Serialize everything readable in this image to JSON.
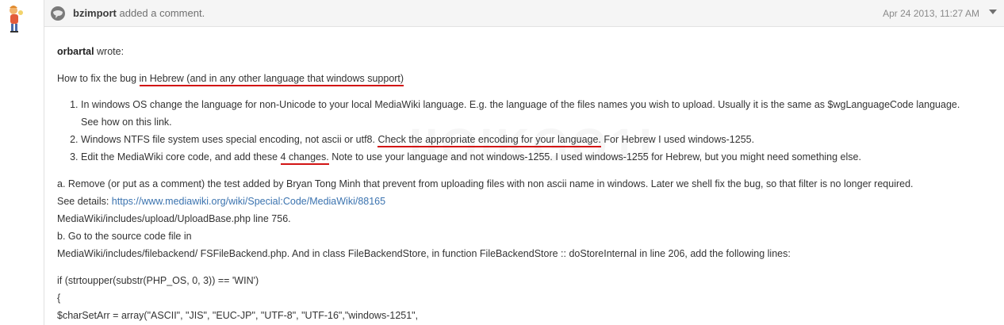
{
  "header": {
    "username": "bzimport",
    "action": "added a comment.",
    "timestamp": "Apr 24 2013, 11:27 AM",
    "icons": {
      "comment": "speech-bubble-icon",
      "menu": "chevron-down-icon",
      "avatar": "user-avatar"
    }
  },
  "quote": {
    "author": "orbartal",
    "wrote": "wrote:"
  },
  "intro": {
    "pre": "How to fix the bug ",
    "underlined": "in Hebrew (and in any other language that windows support)"
  },
  "steps": [
    {
      "text": "In windows OS change the language for non-Unicode to your local MediaWiki language. E.g. the language of the files names you wish to upload. Usually it is the same as $wgLanguageCode language.",
      "line2": "See how on this link."
    },
    {
      "pre": "Windows NTFS file system uses special encoding, not ascii or utf8. ",
      "underlined": "Check the appropriate encoding for your language.",
      "post": " For Hebrew I used windows-1255."
    },
    {
      "pre": "Edit the MediaWiki core code, and add these ",
      "underlined": "4 changes.",
      "post": " Note to use your language and not windows-1255. I used windows-1255 for Hebrew, but you might need something else."
    }
  ],
  "section_a": {
    "line1": "a. Remove (or put as a comment) the test added by Bryan Tong Minh that prevent from uploading files with non ascii name in windows. Later we shell fix the bug, so that filter is no longer required.",
    "details_label": "See details: ",
    "details_link": "https://www.mediawiki.org/wiki/Special:Code/MediaWiki/88165",
    "line3": "MediaWiki/includes/upload/UploadBase.php line 756."
  },
  "section_b": {
    "line1": "b. Go to the source code file in",
    "line2": "MediaWiki/includes/filebackend/ FSFileBackend.php. And in class FileBackendStore, in function FileBackendStore :: doStoreInternal in line 206, add the following lines:"
  },
  "code": {
    "line1": "if (strtoupper(substr(PHP_OS, 0, 3)) == 'WIN')",
    "line2": "{",
    "line3": "$charSetArr = array(\"ASCII\", \"JIS\", \"EUC-JP\", \"UTF-8\", \"UTF-16\",\"windows-1251\","
  },
  "colors": {
    "link": "#3b73af",
    "underline": "#d21414",
    "header_bg": "#f5f5f5"
  }
}
